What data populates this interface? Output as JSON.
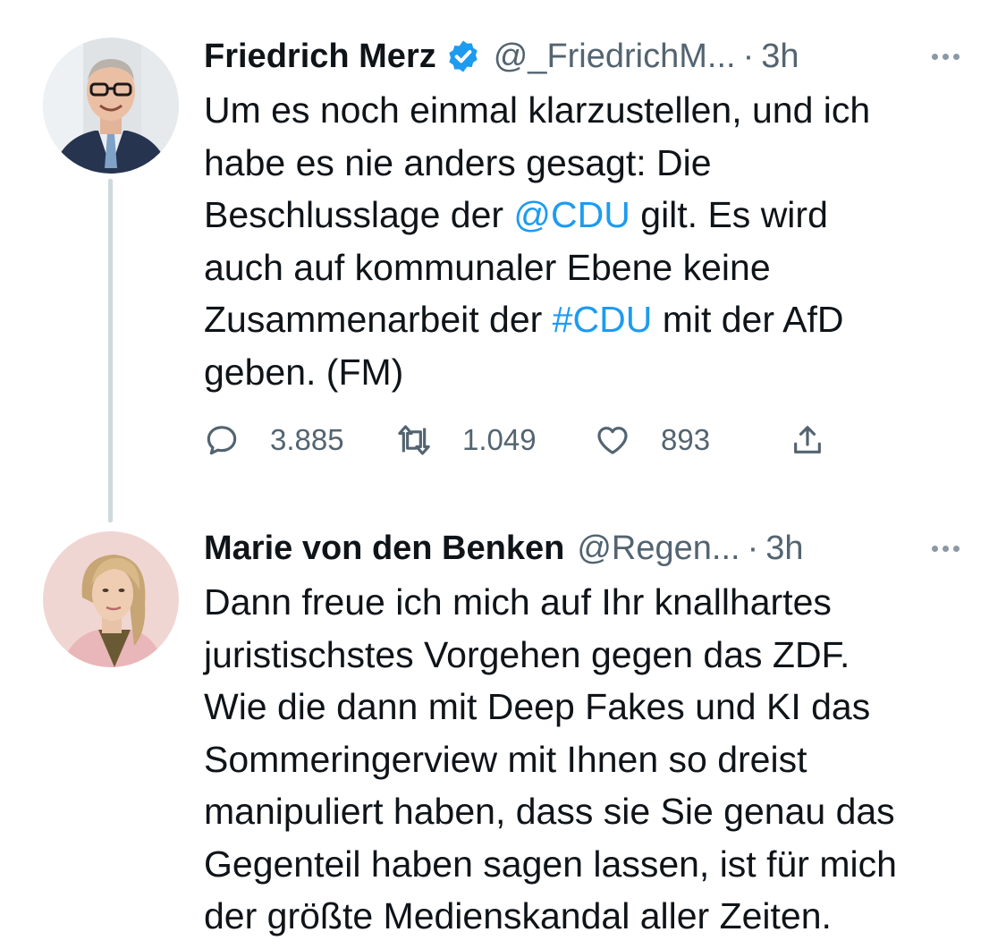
{
  "tweets": [
    {
      "author": {
        "name": "Friedrich Merz",
        "verified": true,
        "handle": "@_FriedrichM...",
        "avatar_icon": "avatar-photo-man"
      },
      "separator": "·",
      "time": "3h",
      "text_lines": [
        [
          "Um es noch einmal klarzustellen, und ich"
        ],
        [
          "habe es nie anders gesagt: Die"
        ],
        [
          "Beschlusslage der ",
          "@CDU",
          " gilt. Es wird"
        ],
        [
          "auch auf kommunaler Ebene keine"
        ],
        [
          "Zusammenarbeit der ",
          "#CDU",
          " mit der AfD"
        ],
        [
          "geben. (FM)"
        ]
      ],
      "mention": "@CDU",
      "hashtag": "#CDU",
      "actions": {
        "replies": "3.885",
        "retweets": "1.049",
        "likes": "893"
      }
    },
    {
      "author": {
        "name": "Marie von den Benken",
        "verified": false,
        "handle": "@Regen...",
        "avatar_icon": "avatar-photo-woman"
      },
      "separator": "·",
      "time": "3h",
      "text_lines": [
        "Dann freue ich mich auf Ihr knallhartes",
        "juristischstes Vorgehen gegen das ZDF.",
        "Wie die dann mit Deep Fakes und KI das",
        "Sommeringerview mit Ihnen so dreist",
        "manipuliert haben, dass sie Sie genau das",
        "Gegenteil haben sagen lassen, ist für mich",
        "der größte Medienskandal aller Zeiten."
      ]
    }
  ],
  "colors": {
    "text": "#0f1419",
    "secondary": "#536471",
    "link": "#1d9bf0",
    "thread_line": "#cfd9de",
    "verified_badge": "#1d9bf0"
  }
}
